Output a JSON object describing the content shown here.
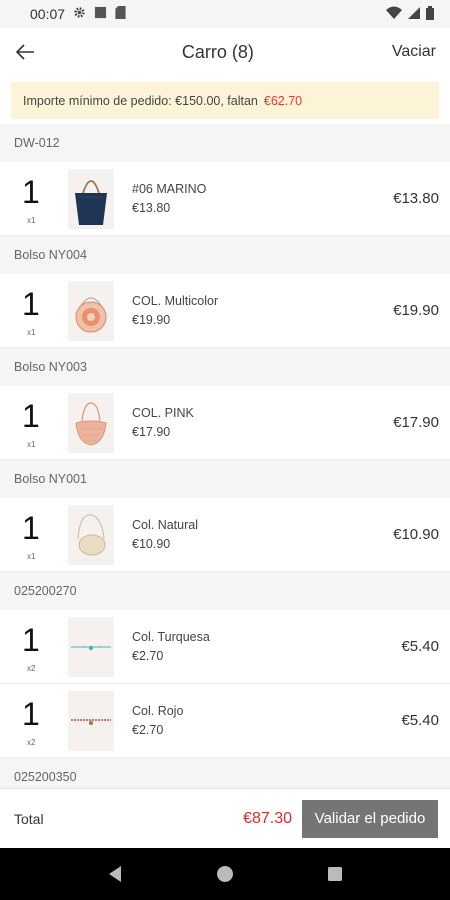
{
  "status": {
    "time": "00:07"
  },
  "header": {
    "title": "Carro (8)",
    "action": "Vaciar"
  },
  "notice": {
    "text": "Importe mínimo de pedido: €150.00, faltan",
    "missing": "€62.70"
  },
  "groups": [
    {
      "header": "DW-012",
      "items": [
        {
          "qty": "1",
          "multiplier": "x1",
          "name": "#06 MARINO",
          "price": "€13.80",
          "total": "€13.80",
          "thumb": "tote-bag"
        }
      ]
    },
    {
      "header": "Bolso NY004",
      "items": [
        {
          "qty": "1",
          "multiplier": "x1",
          "name": "COL. Multicolor",
          "price": "€19.90",
          "total": "€19.90",
          "thumb": "round-bag-multicolor"
        }
      ]
    },
    {
      "header": "Bolso NY003",
      "items": [
        {
          "qty": "1",
          "multiplier": "x1",
          "name": "COL. PINK",
          "price": "€17.90",
          "total": "€17.90",
          "thumb": "round-bag-pink"
        }
      ]
    },
    {
      "header": "Bolso NY001",
      "items": [
        {
          "qty": "1",
          "multiplier": "x1",
          "name": "Col. Natural",
          "price": "€10.90",
          "total": "€10.90",
          "thumb": "crossbody-bag-natural"
        }
      ]
    },
    {
      "header": "025200270",
      "items": [
        {
          "qty": "1",
          "multiplier": "x2",
          "name": "Col. Turquesa",
          "price": "€2.70",
          "total": "€5.40",
          "thumb": "bracelet-turquoise"
        },
        {
          "qty": "1",
          "multiplier": "x2",
          "name": "Col. Rojo",
          "price": "€2.70",
          "total": "€5.40",
          "thumb": "bracelet-red"
        }
      ]
    },
    {
      "header": "025200350",
      "items": []
    }
  ],
  "footer": {
    "total_label": "Total",
    "total_amount": "€87.30",
    "validate_label": "Validar el pedido"
  },
  "colors": {
    "accent_red": "#d32f2f",
    "notice_bg": "#fdf4d8",
    "button_gray": "#757575"
  }
}
